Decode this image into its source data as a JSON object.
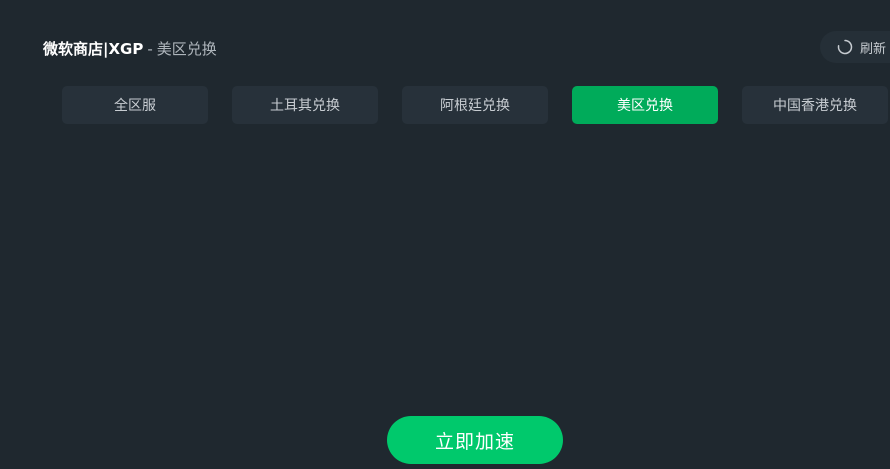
{
  "header": {
    "store_name": "微软商店|XGP",
    "separator": "-",
    "region": "美区兑换"
  },
  "refresh": {
    "label": "刷新",
    "icon": "refresh-icon"
  },
  "tabs": [
    {
      "label": "全区服",
      "active": false
    },
    {
      "label": "土耳其兑换",
      "active": false
    },
    {
      "label": "阿根廷兑换",
      "active": false
    },
    {
      "label": "美区兑换",
      "active": true
    },
    {
      "label": "中国香港兑换",
      "active": false
    }
  ],
  "accelerate": {
    "label": "立即加速"
  },
  "colors": {
    "background": "#1f282f",
    "tab_bg": "#27313a",
    "tab_active": "#00ab5a",
    "accelerate": "#00c96c",
    "text": "#c7ccd1"
  }
}
